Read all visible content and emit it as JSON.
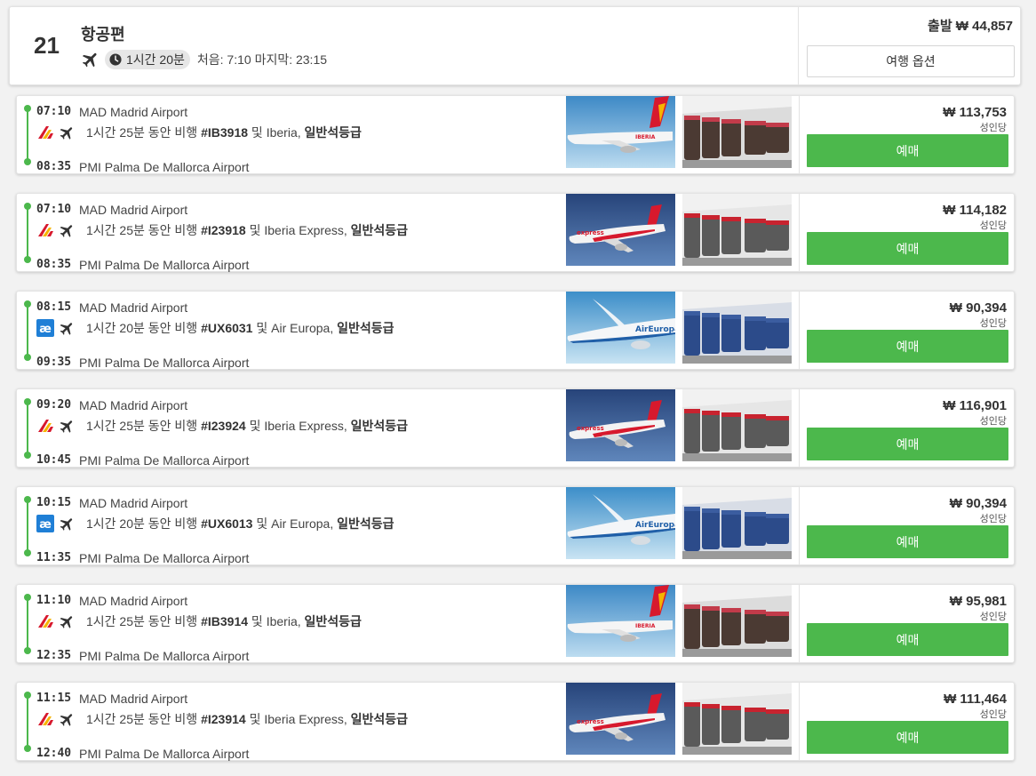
{
  "summary": {
    "count": "21",
    "title": "항공편",
    "duration": "1시간 20분",
    "first_last": "처음: 7:10 마지막: 23:15",
    "departure_price": "출발 ₩ 44,857",
    "trip_options_label": "여행 옵션"
  },
  "labels": {
    "duration_suffix": " 동안 비행 ",
    "and": " 및 ",
    "per_person": "성인당",
    "book": "예매"
  },
  "colors": {
    "accent_green": "#4cb84c",
    "iberia_red": "#d7192d",
    "iberia_yellow": "#f6b400",
    "aireuropa_blue": "#1f7fd6"
  },
  "flights": [
    {
      "dep_time": "07:10",
      "dep_airport": "MAD Madrid Airport",
      "arr_time": "08:35",
      "arr_airport": "PMI Palma De Mallorca Airport",
      "logo": "iberia-logo",
      "duration": "1시간 25분",
      "flight_no": "#IB3918",
      "airline": "Iberia",
      "cabin": "일반석등급",
      "price": "₩ 113,753",
      "plane_img": "iberia-plane-image",
      "cabin_img": "iberia-cabin-image"
    },
    {
      "dep_time": "07:10",
      "dep_airport": "MAD Madrid Airport",
      "arr_time": "08:35",
      "arr_airport": "PMI Palma De Mallorca Airport",
      "logo": "iberia-logo",
      "duration": "1시간 25분",
      "flight_no": "#I23918",
      "airline": "Iberia Express",
      "cabin": "일반석등급",
      "price": "₩ 114,182",
      "plane_img": "iberia-express-plane-image",
      "cabin_img": "iberia-express-cabin-image"
    },
    {
      "dep_time": "08:15",
      "dep_airport": "MAD Madrid Airport",
      "arr_time": "09:35",
      "arr_airport": "PMI Palma De Mallorca Airport",
      "logo": "aireuropa-logo",
      "duration": "1시간 20분",
      "flight_no": "#UX6031",
      "airline": "Air Europa",
      "cabin": "일반석등급",
      "price": "₩ 90,394",
      "plane_img": "aireuropa-plane-image",
      "cabin_img": "aireuropa-cabin-image"
    },
    {
      "dep_time": "09:20",
      "dep_airport": "MAD Madrid Airport",
      "arr_time": "10:45",
      "arr_airport": "PMI Palma De Mallorca Airport",
      "logo": "iberia-logo",
      "duration": "1시간 25분",
      "flight_no": "#I23924",
      "airline": "Iberia Express",
      "cabin": "일반석등급",
      "price": "₩ 116,901",
      "plane_img": "iberia-express-plane-image",
      "cabin_img": "iberia-express-cabin-image"
    },
    {
      "dep_time": "10:15",
      "dep_airport": "MAD Madrid Airport",
      "arr_time": "11:35",
      "arr_airport": "PMI Palma De Mallorca Airport",
      "logo": "aireuropa-logo",
      "duration": "1시간 20분",
      "flight_no": "#UX6013",
      "airline": "Air Europa",
      "cabin": "일반석등급",
      "price": "₩ 90,394",
      "plane_img": "aireuropa-plane-image",
      "cabin_img": "aireuropa-cabin-image"
    },
    {
      "dep_time": "11:10",
      "dep_airport": "MAD Madrid Airport",
      "arr_time": "12:35",
      "arr_airport": "PMI Palma De Mallorca Airport",
      "logo": "iberia-logo",
      "duration": "1시간 25분",
      "flight_no": "#IB3914",
      "airline": "Iberia",
      "cabin": "일반석등급",
      "price": "₩ 95,981",
      "plane_img": "iberia-plane-image",
      "cabin_img": "iberia-cabin-image"
    },
    {
      "dep_time": "11:15",
      "dep_airport": "MAD Madrid Airport",
      "arr_time": "12:40",
      "arr_airport": "PMI Palma De Mallorca Airport",
      "logo": "iberia-logo",
      "duration": "1시간 25분",
      "flight_no": "#I23914",
      "airline": "Iberia Express",
      "cabin": "일반석등급",
      "price": "₩ 111,464",
      "plane_img": "iberia-express-plane-image",
      "cabin_img": "iberia-express-cabin-image"
    }
  ]
}
